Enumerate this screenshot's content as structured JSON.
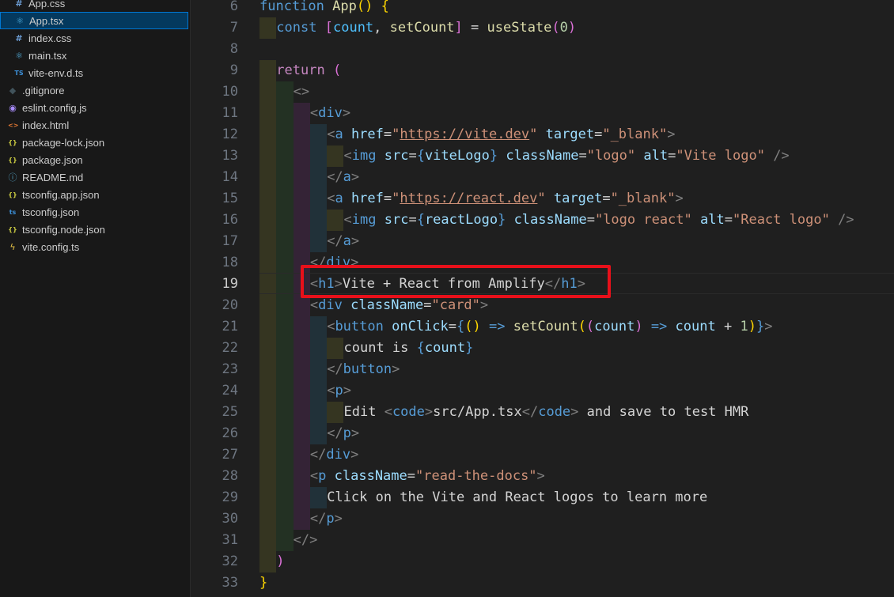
{
  "explorer": {
    "files": [
      {
        "name": "App.css",
        "icon": "hash-icon",
        "glyph": "#",
        "color": "#6b9bd2",
        "indent": 1
      },
      {
        "name": "App.tsx",
        "icon": "react-icon",
        "glyph": "⚛",
        "color": "#56b6e6",
        "indent": 1,
        "selected": true
      },
      {
        "name": "index.css",
        "icon": "hash-icon",
        "glyph": "#",
        "color": "#6b9bd2",
        "indent": 1
      },
      {
        "name": "main.tsx",
        "icon": "react-icon",
        "glyph": "⚛",
        "color": "#56b6e6",
        "indent": 1
      },
      {
        "name": "vite-env.d.ts",
        "icon": "typescript-icon",
        "glyph": "TS",
        "color": "#3c8fd8",
        "indent": 1
      },
      {
        "name": ".gitignore",
        "icon": "git-icon",
        "glyph": "◆",
        "color": "#41535b",
        "indent": 0
      },
      {
        "name": "eslint.config.js",
        "icon": "eslint-icon",
        "glyph": "◉",
        "color": "#a78bfa",
        "indent": 0
      },
      {
        "name": "index.html",
        "icon": "html-icon",
        "glyph": "<>",
        "color": "#e37933",
        "indent": 0
      },
      {
        "name": "package-lock.json",
        "icon": "json-icon",
        "glyph": "{}",
        "color": "#cbcb41",
        "indent": 0
      },
      {
        "name": "package.json",
        "icon": "json-icon",
        "glyph": "{}",
        "color": "#cbcb41",
        "indent": 0
      },
      {
        "name": "README.md",
        "icon": "info-icon",
        "glyph": "ⓘ",
        "color": "#519aba",
        "indent": 0
      },
      {
        "name": "tsconfig.app.json",
        "icon": "json-icon",
        "glyph": "{}",
        "color": "#cbcb41",
        "indent": 0
      },
      {
        "name": "tsconfig.json",
        "icon": "tsconfig-icon",
        "glyph": "ts",
        "color": "#3c8fd8",
        "indent": 0
      },
      {
        "name": "tsconfig.node.json",
        "icon": "json-icon",
        "glyph": "{}",
        "color": "#cbcb41",
        "indent": 0
      },
      {
        "name": "vite.config.ts",
        "icon": "vite-icon",
        "glyph": "ϟ",
        "color": "#e8c547",
        "indent": 0
      }
    ]
  },
  "editor": {
    "active_line": 19,
    "lines": [
      {
        "n": 6,
        "indent": 0,
        "t": [
          [
            "kw",
            "function"
          ],
          [
            "txt",
            " "
          ],
          [
            "fn",
            "App"
          ],
          [
            "b1",
            "()"
          ],
          [
            "txt",
            " "
          ],
          [
            "b1",
            "{"
          ]
        ]
      },
      {
        "n": 7,
        "indent": 1,
        "t": [
          [
            "kw",
            "const"
          ],
          [
            "txt",
            " "
          ],
          [
            "b2",
            "["
          ],
          [
            "var2",
            "count"
          ],
          [
            "txt",
            ", "
          ],
          [
            "fn",
            "setCount"
          ],
          [
            "b2",
            "]"
          ],
          [
            "txt",
            " = "
          ],
          [
            "fn",
            "useState"
          ],
          [
            "b2",
            "("
          ],
          [
            "num",
            "0"
          ],
          [
            "b2",
            ")"
          ]
        ]
      },
      {
        "n": 8,
        "indent": 0,
        "t": []
      },
      {
        "n": 9,
        "indent": 1,
        "t": [
          [
            "kw2",
            "return"
          ],
          [
            "txt",
            " "
          ],
          [
            "b2",
            "("
          ]
        ]
      },
      {
        "n": 10,
        "indent": 2,
        "t": [
          [
            "tagp",
            "<>"
          ]
        ]
      },
      {
        "n": 11,
        "indent": 3,
        "t": [
          [
            "tagp",
            "<"
          ],
          [
            "tag",
            "div"
          ],
          [
            "tagp",
            ">"
          ]
        ]
      },
      {
        "n": 12,
        "indent": 4,
        "t": [
          [
            "tagp",
            "<"
          ],
          [
            "tag",
            "a"
          ],
          [
            "txt",
            " "
          ],
          [
            "attr",
            "href"
          ],
          [
            "txt",
            "="
          ],
          [
            "str",
            "\""
          ],
          [
            "strl",
            "https://vite.dev"
          ],
          [
            "str",
            "\""
          ],
          [
            "txt",
            " "
          ],
          [
            "attr",
            "target"
          ],
          [
            "txt",
            "="
          ],
          [
            "str",
            "\"_blank\""
          ],
          [
            "tagp",
            ">"
          ]
        ]
      },
      {
        "n": 13,
        "indent": 5,
        "t": [
          [
            "tagp",
            "<"
          ],
          [
            "tag",
            "img"
          ],
          [
            "txt",
            " "
          ],
          [
            "attr",
            "src"
          ],
          [
            "txt",
            "="
          ],
          [
            "kw",
            "{"
          ],
          [
            "var",
            "viteLogo"
          ],
          [
            "kw",
            "}"
          ],
          [
            "txt",
            " "
          ],
          [
            "attr",
            "className"
          ],
          [
            "txt",
            "="
          ],
          [
            "str",
            "\"logo\""
          ],
          [
            "txt",
            " "
          ],
          [
            "attr",
            "alt"
          ],
          [
            "txt",
            "="
          ],
          [
            "str",
            "\"Vite logo\""
          ],
          [
            "txt",
            " "
          ],
          [
            "tagp",
            "/>"
          ]
        ]
      },
      {
        "n": 14,
        "indent": 4,
        "t": [
          [
            "tagp",
            "</"
          ],
          [
            "tag",
            "a"
          ],
          [
            "tagp",
            ">"
          ]
        ]
      },
      {
        "n": 15,
        "indent": 4,
        "t": [
          [
            "tagp",
            "<"
          ],
          [
            "tag",
            "a"
          ],
          [
            "txt",
            " "
          ],
          [
            "attr",
            "href"
          ],
          [
            "txt",
            "="
          ],
          [
            "str",
            "\""
          ],
          [
            "strl",
            "https://react.dev"
          ],
          [
            "str",
            "\""
          ],
          [
            "txt",
            " "
          ],
          [
            "attr",
            "target"
          ],
          [
            "txt",
            "="
          ],
          [
            "str",
            "\"_blank\""
          ],
          [
            "tagp",
            ">"
          ]
        ]
      },
      {
        "n": 16,
        "indent": 5,
        "t": [
          [
            "tagp",
            "<"
          ],
          [
            "tag",
            "img"
          ],
          [
            "txt",
            " "
          ],
          [
            "attr",
            "src"
          ],
          [
            "txt",
            "="
          ],
          [
            "kw",
            "{"
          ],
          [
            "var",
            "reactLogo"
          ],
          [
            "kw",
            "}"
          ],
          [
            "txt",
            " "
          ],
          [
            "attr",
            "className"
          ],
          [
            "txt",
            "="
          ],
          [
            "str",
            "\"logo react\""
          ],
          [
            "txt",
            " "
          ],
          [
            "attr",
            "alt"
          ],
          [
            "txt",
            "="
          ],
          [
            "str",
            "\"React logo\""
          ],
          [
            "txt",
            " "
          ],
          [
            "tagp",
            "/>"
          ]
        ]
      },
      {
        "n": 17,
        "indent": 4,
        "t": [
          [
            "tagp",
            "</"
          ],
          [
            "tag",
            "a"
          ],
          [
            "tagp",
            ">"
          ]
        ]
      },
      {
        "n": 18,
        "indent": 3,
        "t": [
          [
            "tagp",
            "</"
          ],
          [
            "tag",
            "div"
          ],
          [
            "tagp",
            ">"
          ]
        ]
      },
      {
        "n": 19,
        "indent": 3,
        "t": [
          [
            "tagp",
            "<"
          ],
          [
            "tag",
            "h1"
          ],
          [
            "tagp",
            ">"
          ],
          [
            "txt",
            "Vite + React from Amplify"
          ],
          [
            "tagp",
            "</"
          ],
          [
            "tag",
            "h1"
          ],
          [
            "tagp",
            ">"
          ]
        ]
      },
      {
        "n": 20,
        "indent": 3,
        "t": [
          [
            "tagp",
            "<"
          ],
          [
            "tag",
            "div"
          ],
          [
            "txt",
            " "
          ],
          [
            "attr",
            "className"
          ],
          [
            "txt",
            "="
          ],
          [
            "str",
            "\"card\""
          ],
          [
            "tagp",
            ">"
          ]
        ]
      },
      {
        "n": 21,
        "indent": 4,
        "t": [
          [
            "tagp",
            "<"
          ],
          [
            "tag",
            "button"
          ],
          [
            "txt",
            " "
          ],
          [
            "attr",
            "onClick"
          ],
          [
            "txt",
            "="
          ],
          [
            "kw",
            "{"
          ],
          [
            "b1",
            "()"
          ],
          [
            "txt",
            " "
          ],
          [
            "kw",
            "=>"
          ],
          [
            "txt",
            " "
          ],
          [
            "fn",
            "setCount"
          ],
          [
            "b1",
            "("
          ],
          [
            "b2",
            "("
          ],
          [
            "var",
            "count"
          ],
          [
            "b2",
            ")"
          ],
          [
            "txt",
            " "
          ],
          [
            "kw",
            "=>"
          ],
          [
            "txt",
            " "
          ],
          [
            "var",
            "count"
          ],
          [
            "txt",
            " + "
          ],
          [
            "num",
            "1"
          ],
          [
            "b1",
            ")"
          ],
          [
            "kw",
            "}"
          ],
          [
            "tagp",
            ">"
          ]
        ]
      },
      {
        "n": 22,
        "indent": 5,
        "t": [
          [
            "txt",
            "count is "
          ],
          [
            "kw",
            "{"
          ],
          [
            "var",
            "count"
          ],
          [
            "kw",
            "}"
          ]
        ]
      },
      {
        "n": 23,
        "indent": 4,
        "t": [
          [
            "tagp",
            "</"
          ],
          [
            "tag",
            "button"
          ],
          [
            "tagp",
            ">"
          ]
        ]
      },
      {
        "n": 24,
        "indent": 4,
        "t": [
          [
            "tagp",
            "<"
          ],
          [
            "tag",
            "p"
          ],
          [
            "tagp",
            ">"
          ]
        ]
      },
      {
        "n": 25,
        "indent": 5,
        "t": [
          [
            "txt",
            "Edit "
          ],
          [
            "tagp",
            "<"
          ],
          [
            "tag",
            "code"
          ],
          [
            "tagp",
            ">"
          ],
          [
            "txt",
            "src/App.tsx"
          ],
          [
            "tagp",
            "</"
          ],
          [
            "tag",
            "code"
          ],
          [
            "tagp",
            ">"
          ],
          [
            "txt",
            " and save to test HMR"
          ]
        ]
      },
      {
        "n": 26,
        "indent": 4,
        "t": [
          [
            "tagp",
            "</"
          ],
          [
            "tag",
            "p"
          ],
          [
            "tagp",
            ">"
          ]
        ]
      },
      {
        "n": 27,
        "indent": 3,
        "t": [
          [
            "tagp",
            "</"
          ],
          [
            "tag",
            "div"
          ],
          [
            "tagp",
            ">"
          ]
        ]
      },
      {
        "n": 28,
        "indent": 3,
        "t": [
          [
            "tagp",
            "<"
          ],
          [
            "tag",
            "p"
          ],
          [
            "txt",
            " "
          ],
          [
            "attr",
            "className"
          ],
          [
            "txt",
            "="
          ],
          [
            "str",
            "\"read-the-docs\""
          ],
          [
            "tagp",
            ">"
          ]
        ]
      },
      {
        "n": 29,
        "indent": 4,
        "t": [
          [
            "txt",
            "Click on the Vite and React logos to learn more"
          ]
        ]
      },
      {
        "n": 30,
        "indent": 3,
        "t": [
          [
            "tagp",
            "</"
          ],
          [
            "tag",
            "p"
          ],
          [
            "tagp",
            ">"
          ]
        ]
      },
      {
        "n": 31,
        "indent": 2,
        "t": [
          [
            "tagp",
            "</>"
          ]
        ]
      },
      {
        "n": 32,
        "indent": 1,
        "t": [
          [
            "b2",
            ")"
          ]
        ]
      },
      {
        "n": 33,
        "indent": 0,
        "t": [
          [
            "b1",
            "}"
          ]
        ]
      }
    ]
  }
}
